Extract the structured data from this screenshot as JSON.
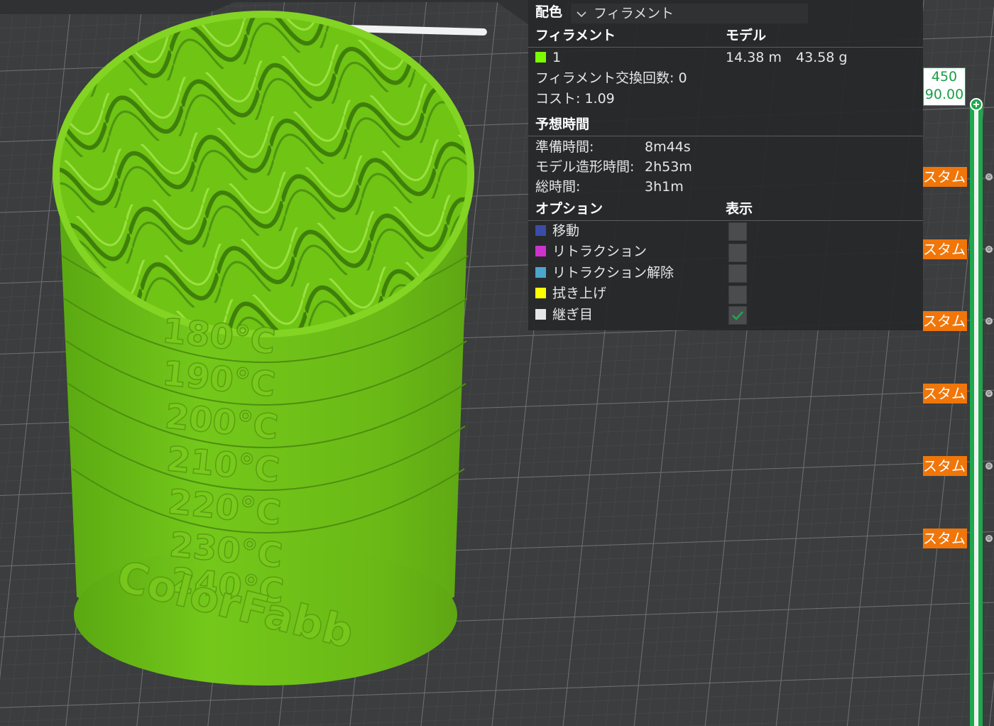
{
  "legend": {
    "color_scheme_label": "配色",
    "color_scheme_value": "フィラメント",
    "header_filament": "フィラメント",
    "header_model": "モデル",
    "filament_row": {
      "id": "1",
      "length": "14.38 m",
      "weight": "43.58 g",
      "color": "#7cfc00"
    },
    "filament_changes": "フィラメント交換回数: 0",
    "cost": "コスト: 1.09",
    "estimated_time_header": "予想時間",
    "prep_label": "準備時間:",
    "prep_value": "8m44s",
    "model_time_label": "モデル造形時間:",
    "model_time_value": "2h53m",
    "total_label": "総時間:",
    "total_value": "3h1m",
    "options_header": "オプション",
    "display_header": "表示",
    "options": [
      {
        "label": "移動",
        "color": "#3a4ca8",
        "checked": false
      },
      {
        "label": "リトラクション",
        "color": "#cc33cc",
        "checked": false
      },
      {
        "label": "リトラクション解除",
        "color": "#4aa6cc",
        "checked": false
      },
      {
        "label": "拭き上げ",
        "color": "#ffff00",
        "checked": false
      },
      {
        "label": "継ぎ目",
        "color": "#e6e6e6",
        "checked": true
      }
    ]
  },
  "slider": {
    "layer": "450",
    "height": "90.00",
    "accent": "#1ea84b",
    "custom_tags": [
      "スタム",
      "スタム",
      "スタム",
      "スタム",
      "スタム",
      "スタム"
    ],
    "gcode_glyph": "G"
  },
  "model": {
    "color": "#6fc414",
    "embossed_labels": [
      "180°C",
      "190°C",
      "200°C",
      "210°C",
      "220°C",
      "230°C",
      "240°C"
    ],
    "brand_text": "ColorFabb"
  }
}
